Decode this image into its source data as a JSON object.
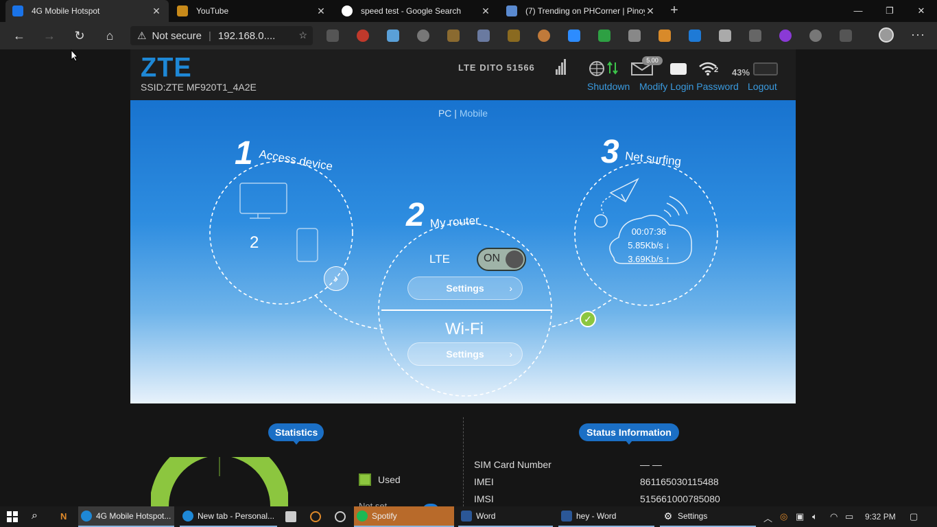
{
  "browser": {
    "tabs": [
      {
        "title": "4G Mobile Hotspot",
        "active": true
      },
      {
        "title": "YouTube",
        "active": false
      },
      {
        "title": "speed test - Google Search",
        "active": false
      },
      {
        "title": "(7) Trending on PHCorner | Pinoy",
        "active": false
      }
    ],
    "address": {
      "security": "Not secure",
      "url": "192.168.0...."
    }
  },
  "router": {
    "logo": "ZTE",
    "ssid": "SSID:ZTE MF920T1_4A2E",
    "network": "LTE   DITO  51566",
    "sms_badge": "5.00",
    "wifi_clients": "2",
    "battery": "43%",
    "links": {
      "shutdown": "Shutdown",
      "modify_password": "Modify Login Password",
      "logout": "Logout"
    },
    "view_pc": "PC",
    "view_sep": "|",
    "view_mobile": "Mobile",
    "step1": {
      "num": "1",
      "title": "Access device",
      "count": "2"
    },
    "step2": {
      "num": "2",
      "title": "My router",
      "lte_label": "LTE",
      "toggle": "ON",
      "settings": "Settings",
      "wifi": "Wi-Fi",
      "wifi_settings": "Settings"
    },
    "step3": {
      "num": "3",
      "title": "Net surfing",
      "time": "00:07:36",
      "down": "5.85Kb/s ↓",
      "up": "3.69Kb/s ↑"
    },
    "statistics": {
      "title": "Statistics",
      "used": "Used",
      "not_set": "Not set",
      "used_fraction": 1.0
    },
    "status": {
      "title": "Status Information",
      "rows": [
        {
          "label": "SIM Card Number",
          "value": "— —"
        },
        {
          "label": "IMEI",
          "value": "861165030115488"
        },
        {
          "label": "IMSI",
          "value": "515661000785080"
        }
      ]
    }
  },
  "taskbar": {
    "items": [
      {
        "label": "4G Mobile Hotspot..."
      },
      {
        "label": "New tab - Personal..."
      },
      {
        "label": "Spotify"
      },
      {
        "label": "Word"
      },
      {
        "label": "hey - Word"
      },
      {
        "label": "Settings"
      }
    ],
    "time": "9:32 PM"
  },
  "colors": {
    "accent": "#1e88d6",
    "hero_top": "#1873cf",
    "stat_green": "#8cc63f",
    "pill": "#1b6fc5"
  }
}
